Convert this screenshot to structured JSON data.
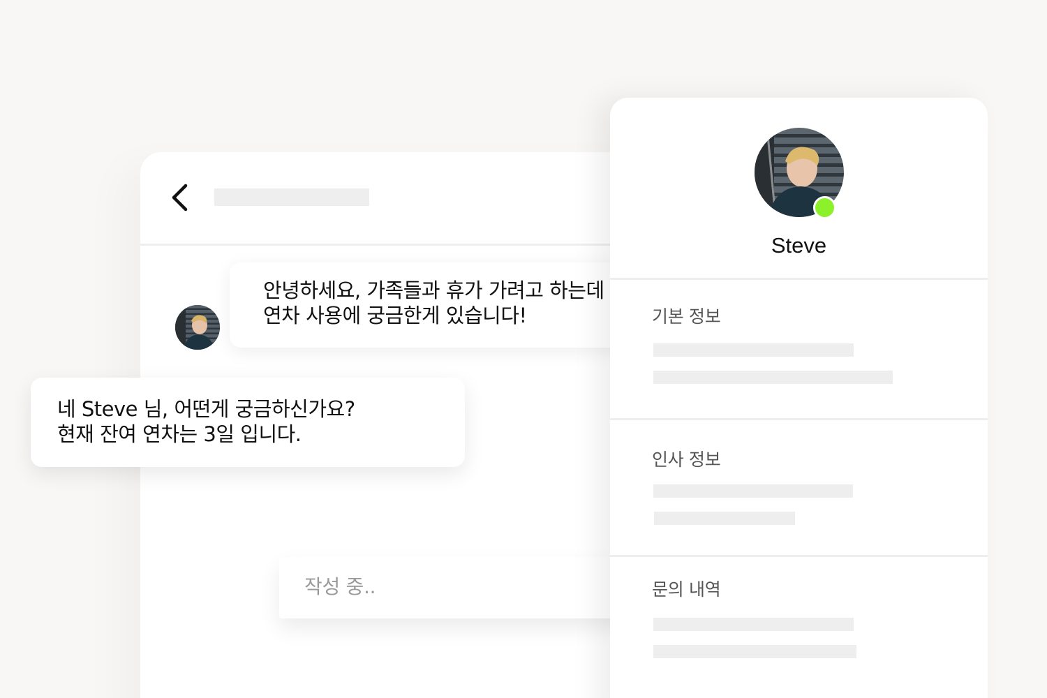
{
  "chat": {
    "incoming_message": {
      "line1": "안녕하세요, 가족들과 휴가 가려고 하는데",
      "line2": "연차 사용에 궁금한게 있습니다!"
    },
    "outgoing_message": {
      "line1": "네 Steve 님, 어떤게 궁금하신가요?",
      "line2": "현재 잔여 연차는 3일 입니다."
    },
    "typing_indicator": "작성 중.."
  },
  "profile": {
    "name": "Steve",
    "status": "online",
    "status_color": "#8cf02a",
    "sections": [
      {
        "title": "기본 정보"
      },
      {
        "title": "인사 정보"
      },
      {
        "title": "문의 내역"
      }
    ]
  },
  "icons": {
    "back": "chevron-left-icon"
  }
}
